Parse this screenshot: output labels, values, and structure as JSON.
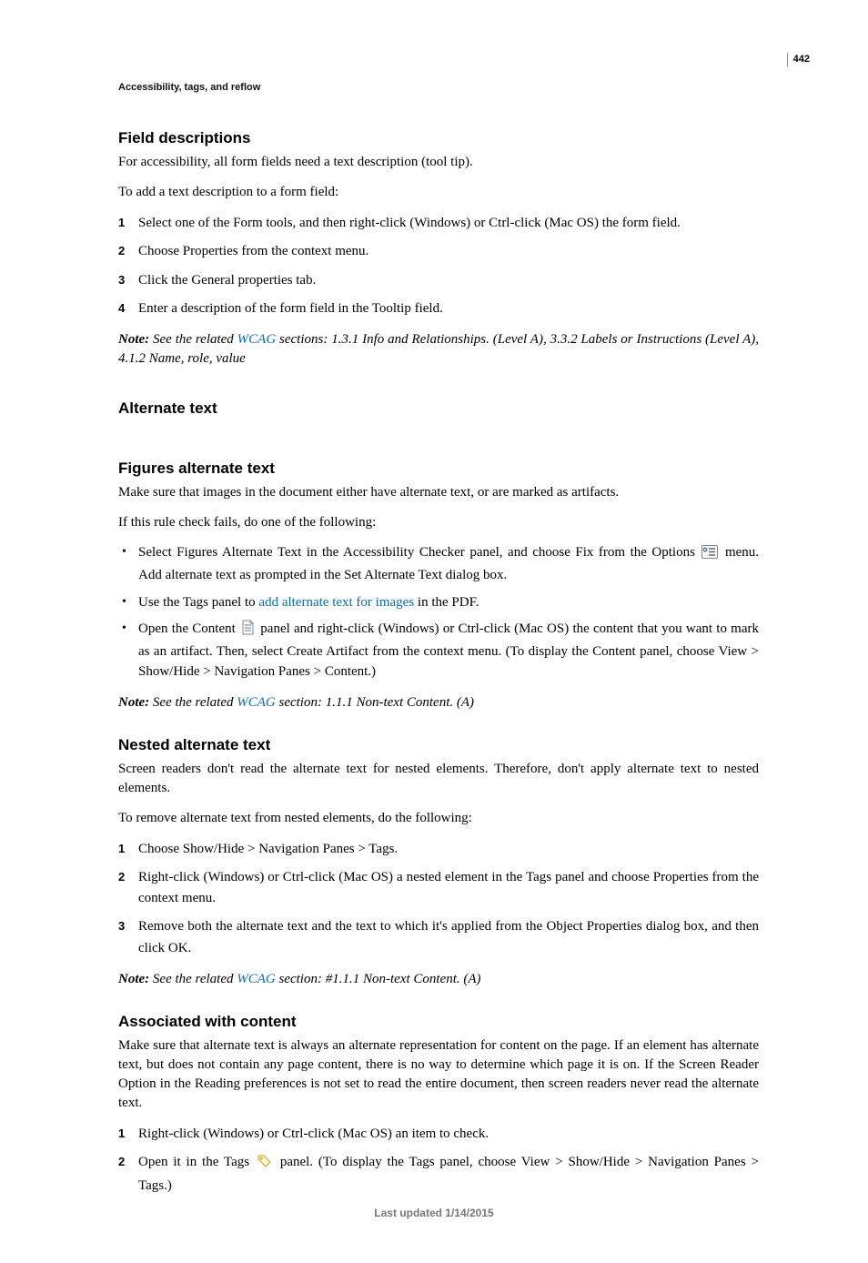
{
  "page_number": "442",
  "breadcrumb": "Accessibility, tags, and reflow",
  "footer": "Last updated 1/14/2015",
  "sec_field_desc": {
    "title": "Field descriptions",
    "p1": "For accessibility, all form fields need a text description (tool tip).",
    "p2": "To add a text description to a form field:",
    "steps": [
      "Select one of the Form tools, and then right-click (Windows) or Ctrl-click (Mac OS) the form field.",
      "Choose Properties from the context menu.",
      "Click the General properties tab.",
      "Enter a description of the form field in the Tooltip field."
    ],
    "note_prefix": "Note:",
    "note_a": " See the related ",
    "note_link": "WCAG",
    "note_b": " sections: 1.3.1 Info and Relationships. (Level A), 3.3.2 Labels or Instructions (Level A), 4.1.2 Name, role, value"
  },
  "sec_alt_text": {
    "title": "Alternate text"
  },
  "sec_figures_alt": {
    "title": "Figures alternate text",
    "p1": "Make sure that images in the document either have alternate text, or are marked as artifacts.",
    "p2": "If this rule check fails, do one of the following:",
    "b1a": "Select Figures Alternate Text in the Accessibility Checker panel, and choose Fix from the Options",
    "b1b": " menu. Add alternate text as prompted in the Set Alternate Text dialog box.",
    "b2a": "Use the Tags panel to ",
    "b2_link": "add alternate text for images",
    "b2b": " in the PDF.",
    "b3a": "Open the Content ",
    "b3b": " panel and right-click (Windows) or Ctrl-click (Mac OS) the content that you want to mark as an artifact. Then, select Create Artifact from the context menu. (To display the Content panel, choose View > Show/Hide > Navigation Panes > Content.)",
    "note_prefix": "Note:",
    "note_a": " See the related ",
    "note_link": "WCAG",
    "note_b": " section: 1.1.1 Non-text Content. (A)"
  },
  "sec_nested_alt": {
    "title": "Nested alternate text",
    "p1": "Screen readers don't read the alternate text for nested elements. Therefore, don't apply alternate text to nested elements.",
    "p2": "To remove alternate text from nested elements, do the following:",
    "steps": [
      "Choose Show/Hide > Navigation Panes > Tags.",
      "Right-click (Windows) or Ctrl-click (Mac OS) a nested element in the Tags panel and choose Properties from the context menu.",
      "Remove both the alternate text and the text to which it's applied from the Object Properties dialog box, and then click OK."
    ],
    "note_prefix": "Note:",
    "note_a": " See the related ",
    "note_link": "WCAG",
    "note_b": " section: #1.1.1 Non-text Content. (A)"
  },
  "sec_assoc": {
    "title": "Associated with content",
    "p1": "Make sure that alternate text is always an alternate representation for content on the page. If an element has alternate text, but does not contain any page content, there is no way to determine which page it is on. If the Screen Reader Option in the Reading preferences is not set to read the entire document, then screen readers never read the alternate text.",
    "s1": "Right-click (Windows) or Ctrl-click (Mac OS) an item to check.",
    "s2a": "Open it in the Tags",
    "s2b": " panel. (To display the Tags panel, choose View > Show/Hide > Navigation Panes > Tags.)"
  }
}
